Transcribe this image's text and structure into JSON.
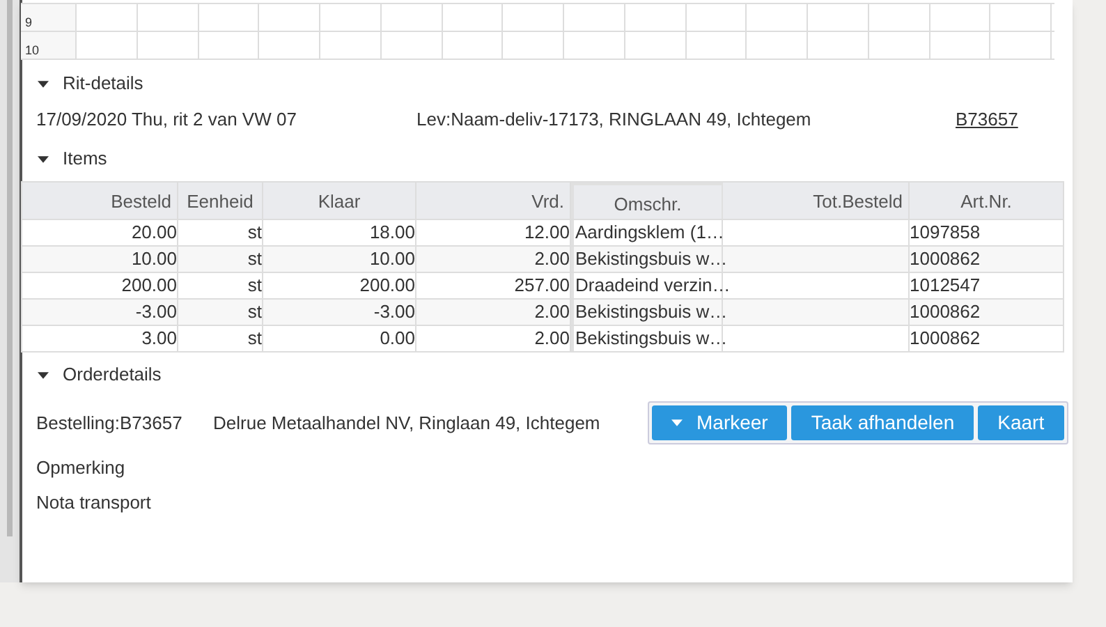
{
  "grid": {
    "row_numbers": [
      "9",
      "10"
    ]
  },
  "sections": [
    {
      "kind": "trip",
      "title": "Rit-details",
      "expanded": true,
      "date": "17/09/2020 Thu, rit 2 van VW 07",
      "supplier": "Lev:Naam-deliv-17173, RINGLAAN 49, Ichtegem",
      "link": "B73657"
    },
    {
      "kind": "items",
      "title": "Items",
      "expanded": true,
      "table": {
        "columns": [
          "Besteld",
          "Eenheid",
          "Klaar",
          "Vrd.",
          "Omschr.",
          "Tot.Besteld",
          "Art.Nr."
        ],
        "rows": [
          [
            "20.00",
            "st",
            "18.00",
            "12.00",
            "Aardingsklem (1…",
            "",
            "1097858"
          ],
          [
            "10.00",
            "st",
            "10.00",
            "2.00",
            "Bekistingsbuis w…",
            "",
            "1000862"
          ],
          [
            "200.00",
            "st",
            "200.00",
            "257.00",
            "Draadeind verzin…",
            "",
            "1012547"
          ],
          [
            "-3.00",
            "st",
            "-3.00",
            "2.00",
            "Bekistingsbuis w…",
            "",
            "1000862"
          ],
          [
            "3.00",
            "st",
            "0.00",
            "2.00",
            "Bekistingsbuis w…",
            "",
            "1000862"
          ]
        ]
      }
    },
    {
      "kind": "order",
      "title": "Orderdetails",
      "expanded": true,
      "order": "Bestelling:B73657",
      "customer": "Delrue Metaalhandel NV, Ringlaan 49, Ichtegem",
      "buttons": [
        {
          "label": "Markeer",
          "kind": "dropdown"
        },
        {
          "label": "Taak afhandelen",
          "kind": "plain"
        },
        {
          "label": "Kaart",
          "kind": "plain"
        }
      ],
      "notes": [
        "Opmerking",
        "Nota transport"
      ]
    }
  ]
}
